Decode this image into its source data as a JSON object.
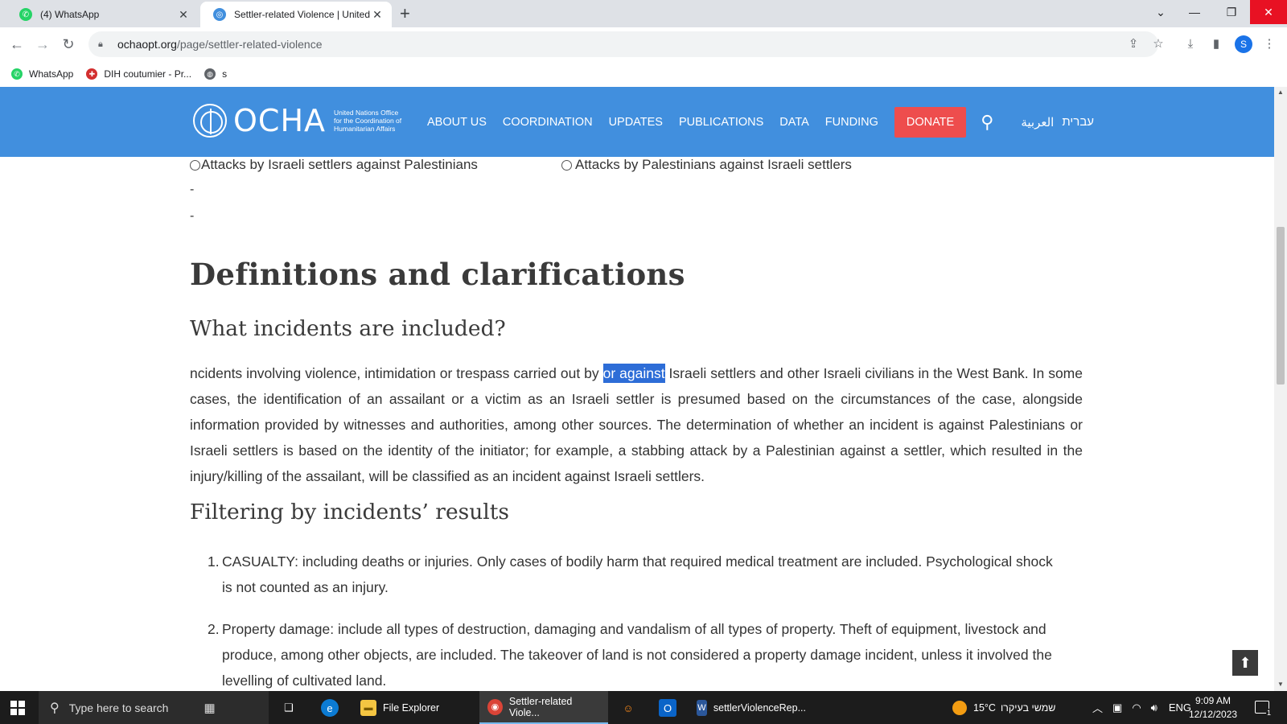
{
  "browser": {
    "tabs": [
      {
        "title": "(4) WhatsApp",
        "active": false,
        "icon": "whatsapp-icon",
        "color": "#25d366"
      },
      {
        "title": "Settler-related Violence | United",
        "active": true,
        "icon": "un-emblem-icon",
        "color": "#418fde"
      }
    ],
    "url_host": "ochaopt.org",
    "url_path": "/page/settler-related-violence",
    "profile_initial": "S",
    "bookmarks": [
      {
        "label": "WhatsApp",
        "icon": "whatsapp-icon",
        "color": "#25d366"
      },
      {
        "label": "DIH coutumier - Pr...",
        "icon": "red-cross-icon",
        "color": "#d32f2f"
      },
      {
        "label": "s",
        "icon": "globe-icon",
        "color": "#5f6368"
      }
    ]
  },
  "site": {
    "logo_text": "OCHA",
    "logo_sub": "United Nations Office for the Coordination of Humanitarian Affairs",
    "nav": [
      "ABOUT US",
      "COORDINATION",
      "UPDATES",
      "PUBLICATIONS",
      "DATA",
      "FUNDING"
    ],
    "donate_label": "DONATE",
    "lang_arabic": "العربية",
    "lang_hebrew": "עברית",
    "colors": {
      "header": "#418fde",
      "donate": "#ee4d4d",
      "highlight": "#2d6dd7"
    }
  },
  "content": {
    "radio_1": "Attacks by Israeli settlers against Palestinians",
    "radio_2": "Attacks by Palestinians against Israeli settlers",
    "dash": "-",
    "h1": "Definitions and clarifications",
    "h2_included": "What incidents are included?",
    "para_before": "ncidents involving violence, intimidation or trespass carried out by ",
    "para_highlight": "or against",
    "para_after": " Israeli settlers and other Israeli civilians in the West Bank. In some cases, the identification of an assailant or a victim as an Israeli settler is presumed based on the circumstances of the case, alongside information provided by witnesses and authorities, among other sources. The determination of whether an incident is against Palestinians or Israeli settlers is based on the identity of the initiator; for example, a stabbing attack by a Palestinian against a settler, which resulted in the injury/killing of the assailant, will be classified as an incident against Israeli settlers.",
    "h2_filtering": "Filtering by incidents’ results",
    "results": [
      {
        "num": "1.",
        "text": "CASUALTY: including deaths or injuries. Only cases of bodily harm that required medical treatment are included. Psychological shock is not counted as an injury."
      },
      {
        "num": "2.",
        "text": "Property damage: include all types of destruction, damaging and vandalism of all types of property. Theft of equipment, livestock and produce, among other objects, are included. The takeover of land is not considered a property damage incident, unless it involved the levelling of cultivated land."
      }
    ]
  },
  "taskbar": {
    "search_placeholder": "Type here to search",
    "apps": [
      {
        "label": "File Explorer",
        "icon": "folder-icon",
        "active": false
      },
      {
        "label": "Settler-related Viole...",
        "icon": "chrome-icon",
        "active": true
      },
      {
        "label": "settlerViolenceRep...",
        "icon": "word-icon",
        "active": false
      }
    ],
    "weather": "15°C",
    "weather_desc": "שמשי בעיקרו",
    "lang": "ENG",
    "time": "9:09 AM",
    "date": "12/12/2023",
    "notif_count": "1"
  }
}
